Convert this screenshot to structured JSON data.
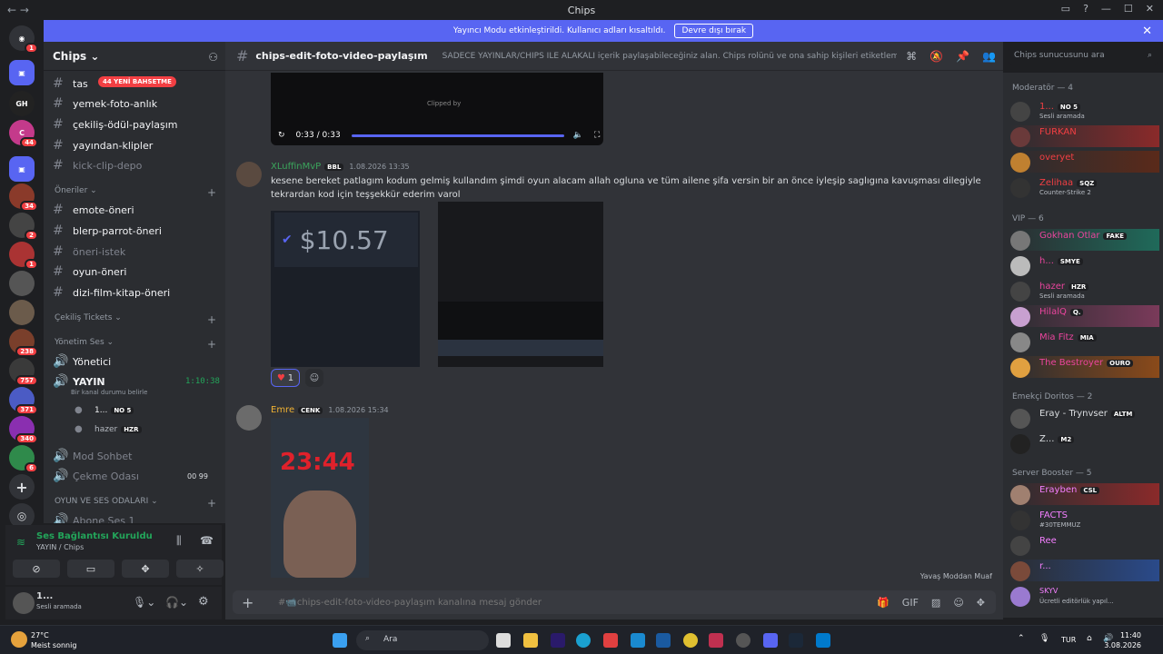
{
  "window": {
    "title": "Chips"
  },
  "banner": {
    "text": "Yayıncı Modu etkinleştirildi. Kullanıcı adları kısaltıldı.",
    "button": "Devre dışı bırak"
  },
  "server": {
    "name": "Chips"
  },
  "mention_pill": "44 YENİ BAHSETME",
  "guild_badges": [
    "1",
    "44",
    "34",
    "2",
    "1",
    "238",
    "757",
    "371",
    "340",
    "6"
  ],
  "channels": [
    {
      "name": "tas",
      "muted": false
    },
    {
      "name": "yemek-foto-anlık",
      "muted": false
    },
    {
      "name": "çekiliş-ödül-paylaşım",
      "muted": false
    },
    {
      "name": "yayından-klipler",
      "muted": false
    },
    {
      "name": "kick-clip-depo",
      "muted": true
    }
  ],
  "categories": {
    "oneriler": "Öneriler",
    "cekilis": "Çekiliş Tickets",
    "yonetim": "Yönetim Ses",
    "oyun": "OYUN VE SES ODALARI"
  },
  "oneri_channels": [
    "emote-öneri",
    "blerp-parrot-öneri",
    "öneri-istek",
    "oyun-öneri",
    "dizi-film-kitap-öneri"
  ],
  "voice": {
    "yonetici": "Yönetici",
    "yayin": "YAYIN",
    "yayin_time": "1:10:38",
    "status": "Bir kanal durumu belirle",
    "user1": "1...",
    "user1_tag": "NO 5",
    "user2": "hazer",
    "user2_tag": "HZR",
    "mod": "Mod Sohbet",
    "cekme": "Çekme Odası",
    "cekme_counts": "00  99",
    "abone": "Abone Ses 1"
  },
  "voice_connection": {
    "title": "Ses Bağlantısı Kuruldu",
    "sub": "YAYIN / Chips"
  },
  "user_panel": {
    "name": "1...",
    "status": "Sesli aramada"
  },
  "channel_header": {
    "name": "chips-edit-foto-video-paylaşım",
    "topic": "SADECE YAYINLAR/CHIPS İLE ALAKALI içerik paylaşabileceğiniz alan. Chips rolünü ve ona sahip kişileri etiketlemek yasaktır.",
    "search_placeholder": "Chips sunucusunu ara"
  },
  "video": {
    "time": "0:33 / 0:33",
    "caption": "Clipped by"
  },
  "messages": [
    {
      "author": "XLuffinMvP",
      "author_color": "#3ba55c",
      "tag": "BBL",
      "time": "1.08.2026 13:35",
      "text": "kesene bereket patlagım kodum gelmiş kullandım şimdi oyun alacam allah ogluna ve tüm ailene şifa versin  bir an önce iyleşip saglıgına kavuşması dilegiyle tekrardan kod için teşşekkür ederim varol",
      "price": "$10.57",
      "reaction_count": "1"
    },
    {
      "author": "Emre",
      "author_color": "#f0b232",
      "tag": "CENK",
      "time": "1.08.2026 15:34",
      "clock": "23:44"
    }
  ],
  "slowmode": "Yavaş Moddan Muaf",
  "input": {
    "placeholder": "#📹chips-edit-foto-video-paylaşım kanalına mesaj gönder"
  },
  "member_categories": {
    "mod": "Moderatör — 4",
    "vip": "VIP — 6",
    "emekci": "Emekçi Doritos — 2",
    "booster": "Server Booster — 5"
  },
  "members": [
    {
      "name": "1...",
      "tag": "NO 5",
      "status": "Sesli aramada",
      "color": "#f23f43"
    },
    {
      "name": "FURKAN",
      "color": "#f23f43"
    },
    {
      "name": "overyet",
      "color": "#f23f43"
    },
    {
      "name": "Zelihaa",
      "tag": "SQZ",
      "status": "Counter-Strike 2",
      "color": "#f23f43"
    },
    {
      "name": "Gokhan Otlar",
      "tag": "FAKE",
      "color": "#eb459e"
    },
    {
      "name": "h...",
      "tag": "SMYE",
      "color": "#eb459e"
    },
    {
      "name": "hazer",
      "tag": "HZR",
      "status": "Sesli aramada",
      "color": "#eb459e"
    },
    {
      "name": "HilalQ",
      "tag": "Q.",
      "color": "#eb459e"
    },
    {
      "name": "Mia Fitz",
      "tag": "MIA",
      "color": "#eb459e"
    },
    {
      "name": "The Bestroyer",
      "tag": "OURO",
      "color": "#eb459e"
    },
    {
      "name": "Eray - Trynvser",
      "tag": "ALTM",
      "color": "#dbdee1"
    },
    {
      "name": "Z...",
      "tag": "M2",
      "color": "#dbdee1"
    },
    {
      "name": "Erayben",
      "tag": "CSL",
      "color": "#f47fff"
    },
    {
      "name": "FACTS",
      "status": "#30TEMMUZ",
      "color": "#f47fff"
    },
    {
      "name": "Ree",
      "color": "#f47fff"
    },
    {
      "name": "r...",
      "color": "#f47fff"
    },
    {
      "name": "SKYV",
      "status": "Ücretli editörlük yapıl...",
      "color": "#f47fff"
    }
  ],
  "taskbar": {
    "temp": "27°C",
    "weather": "Meist sonnig",
    "search": "Ara",
    "lang": "TUR",
    "time": "11:40",
    "date": "3.08.2026"
  }
}
